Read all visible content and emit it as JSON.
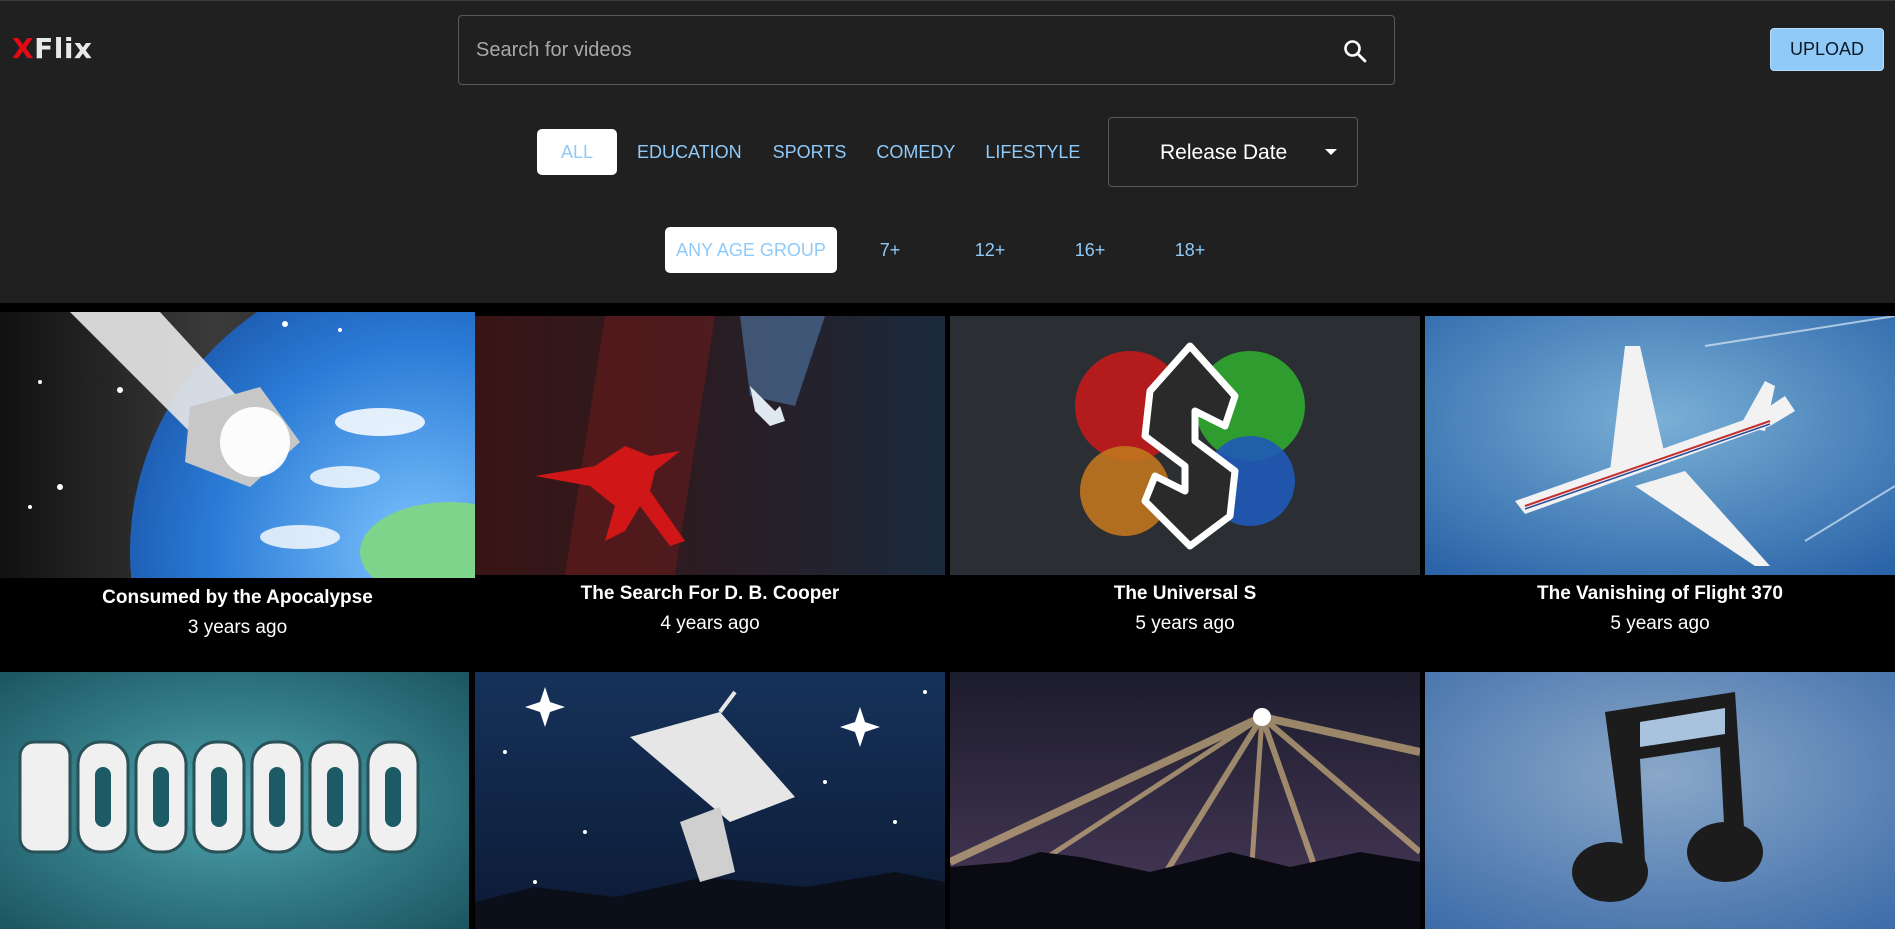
{
  "app": {
    "logo_x": "X",
    "logo_rest": "Flix",
    "upload_label": "UPLOAD"
  },
  "search": {
    "placeholder": "Search for videos",
    "icon": "search-icon"
  },
  "genres": [
    "ALL",
    "EDUCATION",
    "SPORTS",
    "COMEDY",
    "LIFESTYLE"
  ],
  "selected_genre": "ALL",
  "sort": {
    "selected": "Release Date",
    "icon": "chevron-down-icon"
  },
  "age_groups": [
    "ANY AGE GROUP",
    "7+",
    "12+",
    "16+",
    "18+"
  ],
  "selected_age_group": "ANY AGE GROUP",
  "colors": {
    "accent": "#90caf9",
    "brand_red": "#e50914",
    "header_bg": "#202020",
    "content_bg": "#000000"
  },
  "videos": [
    {
      "title": "Consumed by the Apocalypse",
      "released": "3 years ago",
      "thumbnail": "comet-hitting-earth"
    },
    {
      "title": "The Search For D. B. Cooper",
      "released": "4 years ago",
      "thumbnail": "red-figure-parachuting-from-plane"
    },
    {
      "title": "The Universal S",
      "released": "5 years ago",
      "thumbnail": "letter-s-paint-splatter"
    },
    {
      "title": "The Vanishing of Flight 370",
      "released": "5 years ago",
      "thumbnail": "white-airliner-blue-sky"
    },
    {
      "title": "",
      "released": "",
      "thumbnail": "3000000-number"
    },
    {
      "title": "",
      "released": "",
      "thumbnail": "radio-telescope-starry-sky"
    },
    {
      "title": "",
      "released": "",
      "thumbnail": "bright-star-light-rays"
    },
    {
      "title": "",
      "released": "",
      "thumbnail": "music-note"
    }
  ]
}
